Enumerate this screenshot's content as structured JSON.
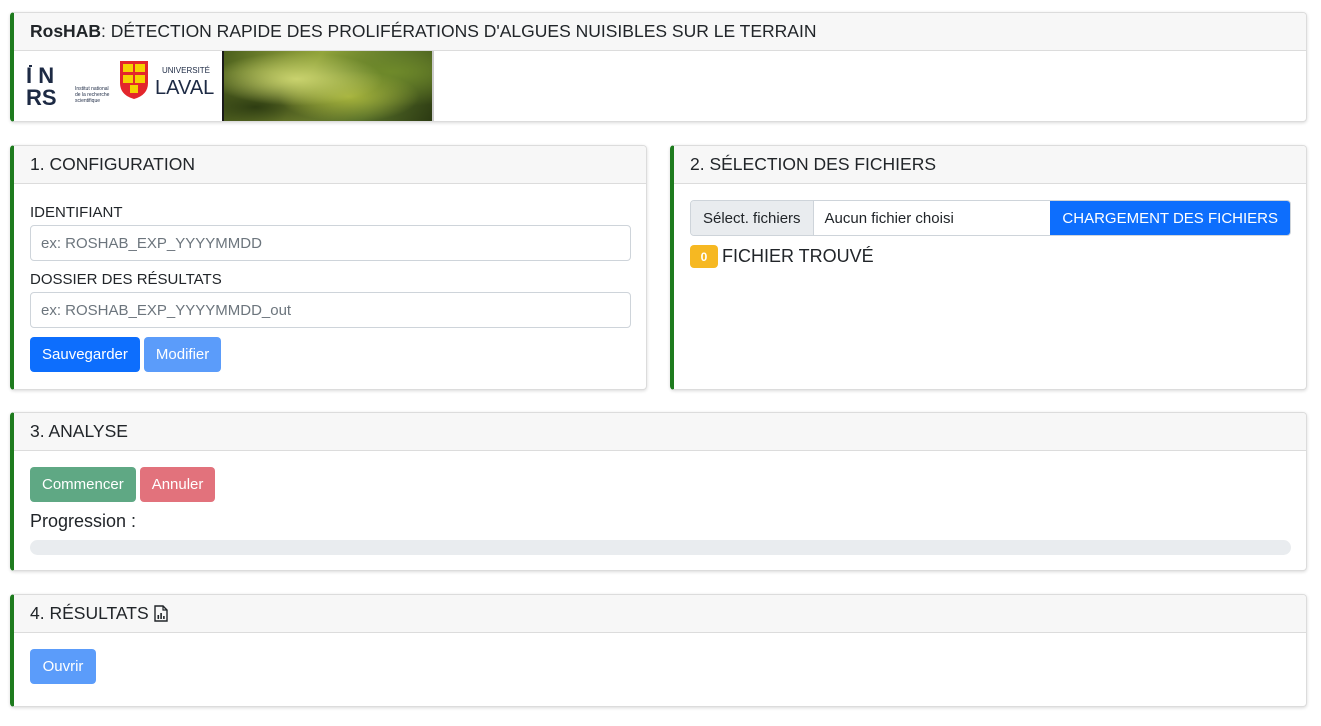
{
  "header": {
    "app_name": "RosHAB",
    "title_rest": " : DÉTECTION RAPIDE DES PROLIFÉRATIONS D'ALGUES NUISIBLES SUR LE TERRAIN",
    "inrs_logo_text": "INRS",
    "inrs_caption": "Institut national de la recherche scientifique",
    "laval_small": "UNIVERSITÉ",
    "laval_big": "LAVAL"
  },
  "config": {
    "title": "1. CONFIGURATION",
    "identifier_label": "IDENTIFIANT",
    "identifier_value": "",
    "identifier_placeholder": "ex: ROSHAB_EXP_YYYYMMDD",
    "folder_label": "DOSSIER DES RÉSULTATS",
    "folder_value": "",
    "folder_placeholder": "ex: ROSHAB_EXP_YYYYMMDD_out",
    "save_label": "Sauvegarder",
    "edit_label": "Modifier"
  },
  "files": {
    "title": "2. SÉLECTION DES FICHIERS",
    "select_label": "Sélect. fichiers",
    "no_file_label": "Aucun fichier choisi",
    "upload_label": "CHARGEMENT DES FICHIERS",
    "count": "0",
    "found_label": "FICHIER TROUVÉ"
  },
  "analysis": {
    "title": "3. ANALYSE",
    "start_label": "Commencer",
    "cancel_label": "Annuler",
    "progress_label": "Progression :",
    "progress_fraction": 0
  },
  "results": {
    "title": "4. RÉSULTATS",
    "title_icon": "file-chart-icon",
    "open_label": "Ouvrir"
  },
  "colors": {
    "card_accent": "#1e7b1e",
    "primary": "#0d6efd",
    "badge_warning": "#f6b822"
  }
}
